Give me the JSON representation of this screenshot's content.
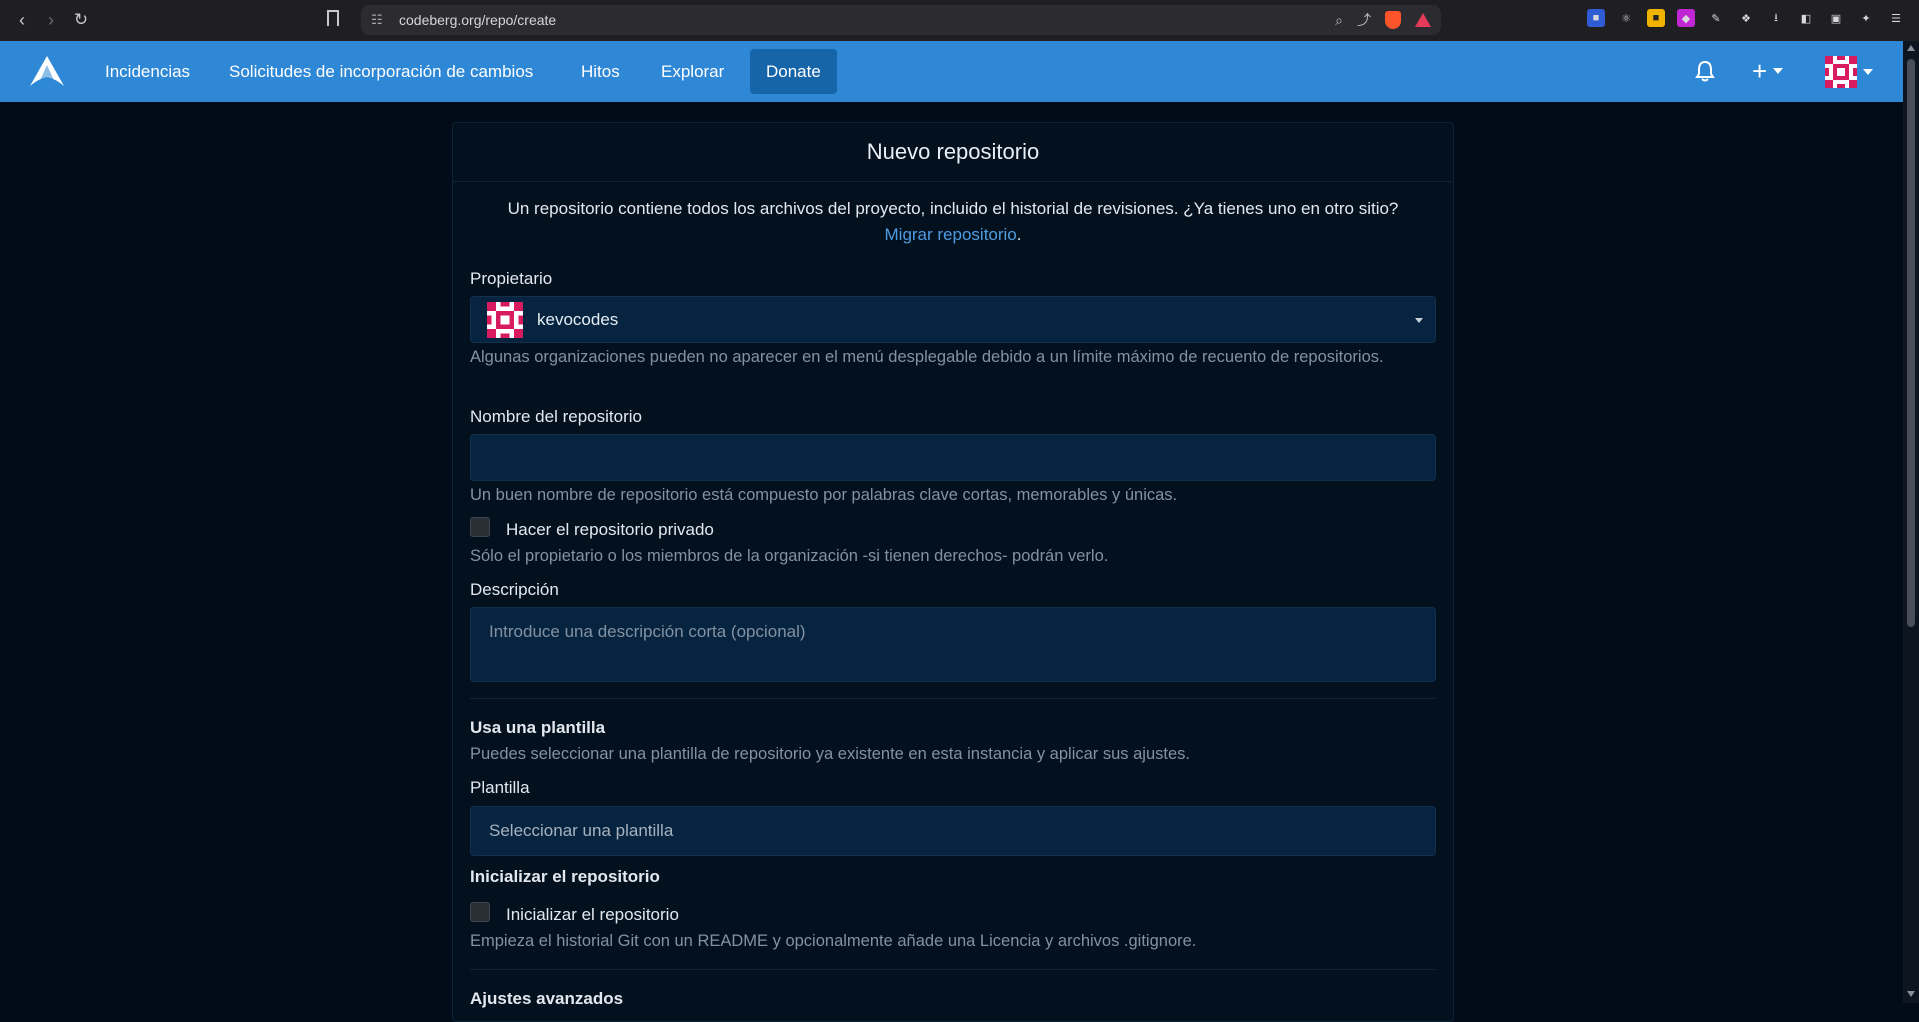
{
  "browser": {
    "url": "codeberg.org/repo/create"
  },
  "navbar": {
    "items": [
      "Incidencias",
      "Solicitudes de incorporación de cambios",
      "Hitos",
      "Explorar"
    ],
    "donate_label": "Donate"
  },
  "page": {
    "title": "Nuevo repositorio",
    "intro_text": "Un repositorio contiene todos los archivos del proyecto, incluido el historial de revisiones. ¿Ya tienes uno en otro sitio?",
    "migrate_link": "Migrar repositorio",
    "migrate_suffix": "."
  },
  "owner": {
    "label": "Propietario",
    "value": "kevocodes",
    "help": "Algunas organizaciones pueden no aparecer en el menú desplegable debido a un límite máximo de recuento de repositorios."
  },
  "repo_name": {
    "label": "Nombre del repositorio",
    "value": "",
    "help": "Un buen nombre de repositorio está compuesto por palabras clave cortas, memorables y únicas."
  },
  "private": {
    "label": "Hacer el repositorio privado",
    "checked": false,
    "help": "Sólo el propietario o los miembros de la organización -si tienen derechos- podrán verlo."
  },
  "description": {
    "label": "Descripción",
    "placeholder": "Introduce una descripción corta (opcional)"
  },
  "template_section": {
    "heading": "Usa una plantilla",
    "help": "Puedes seleccionar una plantilla de repositorio ya existente en esta instancia y aplicar sus ajustes.",
    "label": "Plantilla",
    "placeholder": "Seleccionar una plantilla"
  },
  "init_section": {
    "heading": "Inicializar el repositorio",
    "checkbox_label": "Inicializar el repositorio",
    "checked": false,
    "help": "Empieza el historial Git con un README y opcionalmente añade una Licencia y archivos .gitignore."
  },
  "advanced": {
    "heading": "Ajustes avanzados"
  },
  "colors": {
    "navbar": "#2e88d6",
    "donate": "#1565a8",
    "background": "#020c18",
    "link": "#4e9be0",
    "avatar": "#d81b60"
  }
}
